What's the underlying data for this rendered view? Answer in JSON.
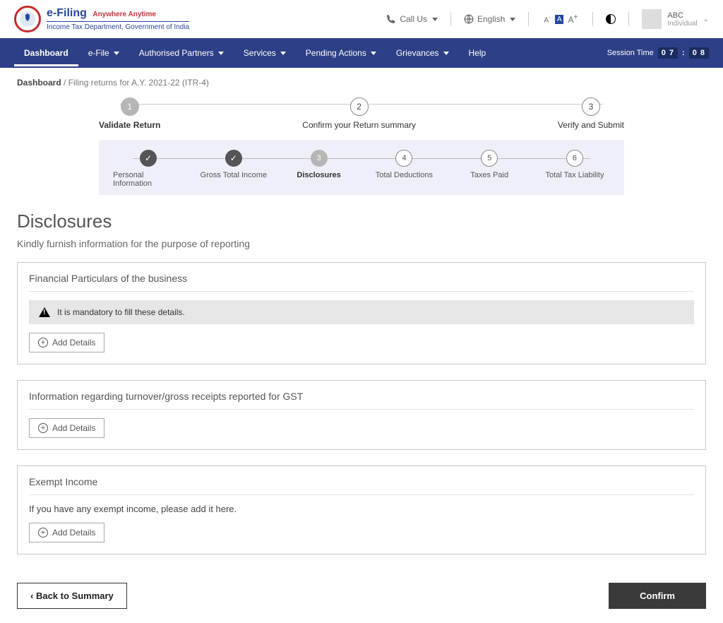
{
  "brand": {
    "title": "e-Filing",
    "tagline": "Anywhere Anytime",
    "subtitle": "Income Tax Department, Government of India"
  },
  "topbar": {
    "call": "Call Us",
    "lang": "English",
    "user_name": "ABC",
    "user_type": "Individual"
  },
  "nav": {
    "items": [
      "Dashboard",
      "e-File",
      "Authorised Partners",
      "Services",
      "Pending Actions",
      "Grievances",
      "Help"
    ],
    "session_label": "Session Time",
    "session_mm": "0 7",
    "session_ss": "0 8"
  },
  "crumb": {
    "root": "Dashboard",
    "rest": "/ Filing returns for A.Y. 2021-22 (ITR-4)"
  },
  "outer_steps": {
    "s1": "Validate Return",
    "s2": "Confirm your Return summary",
    "s3": "Verify and Submit"
  },
  "inner_steps": {
    "s1": "Personal Information",
    "s2": "Gross Total Income",
    "s3": "Disclosures",
    "s4": "Total Deductions",
    "s5": "Taxes Paid",
    "s6": "Total Tax Liability"
  },
  "page": {
    "title": "Disclosures",
    "subtitle": "Kindly furnish information for the purpose of reporting"
  },
  "panel1": {
    "title": "Financial Particulars of the business",
    "alert": "It is mandatory to fill these details.",
    "add": "Add Details"
  },
  "panel2": {
    "title": "Information regarding turnover/gross receipts reported for GST",
    "add": "Add Details"
  },
  "panel3": {
    "title": "Exempt Income",
    "note": "If you have any exempt income, please add it here.",
    "add": "Add Details"
  },
  "footer": {
    "back": "Back to Summary",
    "confirm": "Confirm"
  }
}
